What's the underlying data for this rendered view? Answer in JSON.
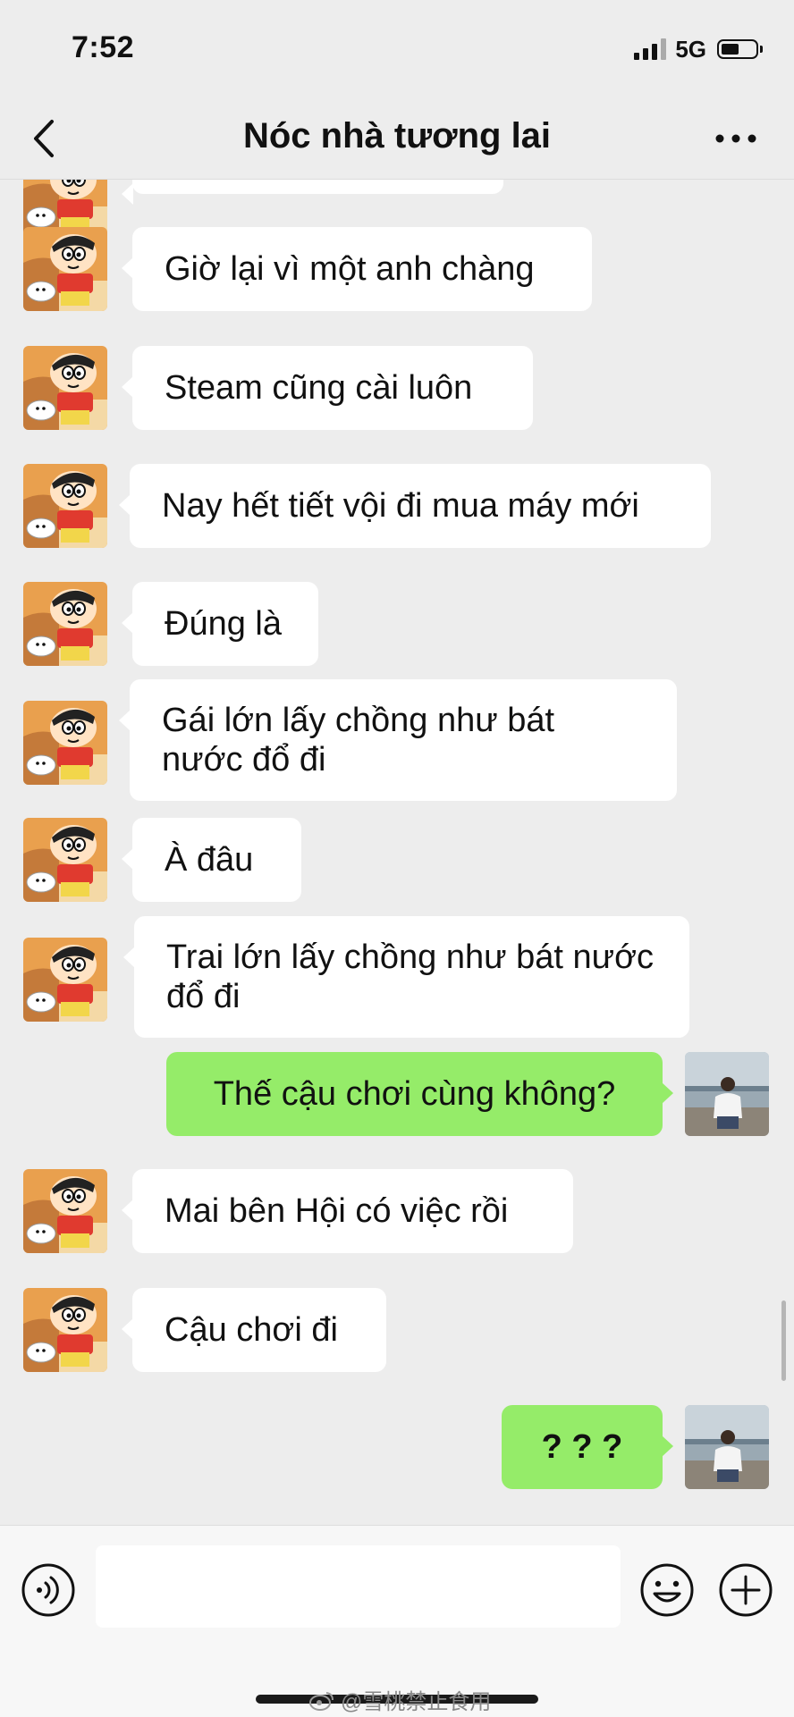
{
  "status_bar": {
    "time": "7:52",
    "network": "5G"
  },
  "nav": {
    "title": "Nóc nhà tương lai"
  },
  "messages": [
    {
      "from": "friend",
      "text": "Giờ lại vì một anh chàng"
    },
    {
      "from": "friend",
      "text": "Steam cũng cài luôn"
    },
    {
      "from": "friend",
      "text": "Nay hết tiết vội đi mua máy mới"
    },
    {
      "from": "friend",
      "text": "Đúng là"
    },
    {
      "from": "friend",
      "text": "Gái lớn lấy chồng như bát nước đổ đi"
    },
    {
      "from": "friend",
      "text": "À đâu"
    },
    {
      "from": "friend",
      "text": "Trai lớn lấy chồng như bát nước đổ đi"
    },
    {
      "from": "me",
      "text": "Thế cậu chơi cùng không?"
    },
    {
      "from": "friend",
      "text": "Mai bên Hội có việc rồi"
    },
    {
      "from": "friend",
      "text": "Cậu chơi đi"
    },
    {
      "from": "me",
      "text": "? ? ?"
    }
  ],
  "input": {
    "value": ""
  },
  "watermark": {
    "text": "@雪桃禁止食用"
  },
  "icons": {
    "back": "chevron-left-icon",
    "more": "more-horizontal-icon",
    "voice": "voice-icon",
    "emoji": "emoji-icon",
    "plus": "plus-icon"
  },
  "colors": {
    "background": "#ededed",
    "my_bubble": "#95ec69",
    "friend_bubble": "#ffffff"
  }
}
